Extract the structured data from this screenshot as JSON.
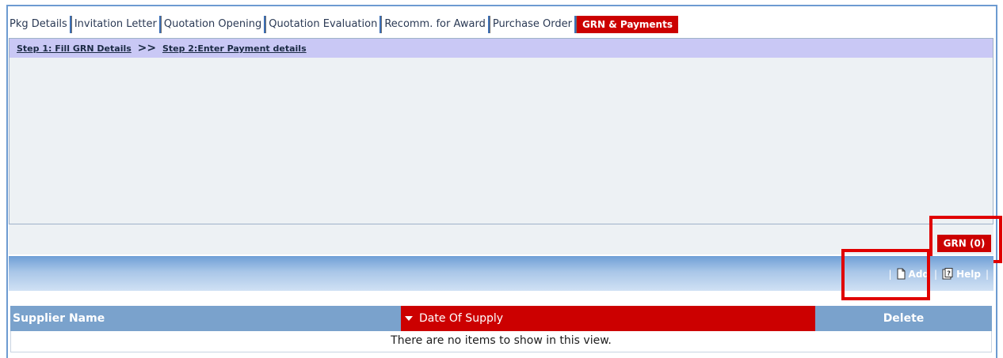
{
  "tabs": [
    {
      "label": "Pkg Details"
    },
    {
      "label": "Invitation Letter"
    },
    {
      "label": "Quotation Opening"
    },
    {
      "label": "Quotation Evaluation"
    },
    {
      "label": "Recomm. for Award"
    },
    {
      "label": "Purchase Order"
    },
    {
      "label": "GRN & Payments",
      "active": true
    }
  ],
  "steps": {
    "step1": "Step 1: Fill GRN Details",
    "separator": ">>",
    "step2": "Step 2:Enter Payment details"
  },
  "grn_button": "GRN (0)",
  "toolbar": {
    "separator": "|",
    "add_label": "Add",
    "help_label": "Help",
    "add_icon": "document-icon",
    "help_icon": "help-icon"
  },
  "table": {
    "columns": [
      "Supplier Name",
      "Date Of Supply",
      "Delete"
    ],
    "sorted_column": "Date Of Supply",
    "empty_message": "There are no items to show in this view."
  },
  "colors": {
    "active_tab": "#cc0000",
    "steps_bar": "#c9c8f5",
    "header_blue": "#7aa2cc",
    "highlight": "#e00000"
  }
}
